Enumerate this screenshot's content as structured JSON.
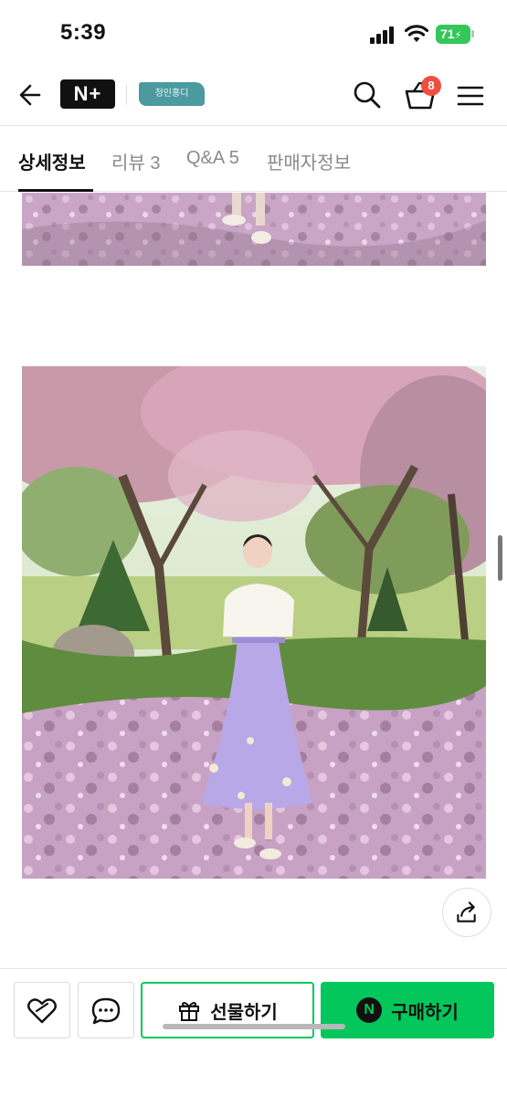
{
  "status_bar": {
    "time": "5:39",
    "battery": "71"
  },
  "header": {
    "logo_text": "N+",
    "store_logo_text": "청인홍디",
    "cart_count": "8"
  },
  "tabs": [
    {
      "label": "상세정보"
    },
    {
      "label": "리뷰 3"
    },
    {
      "label": "Q&A 5"
    },
    {
      "label": "판매자정보"
    }
  ],
  "bottom_bar": {
    "gift_label": "선물하기",
    "buy_label": "구매하기",
    "buy_badge": "N"
  },
  "colors": {
    "accent_green": "#03c75a",
    "badge_red": "#f04e3e",
    "skirt_lavender": "#b9a8e8",
    "blossom_pink": "#d9a6c8"
  }
}
